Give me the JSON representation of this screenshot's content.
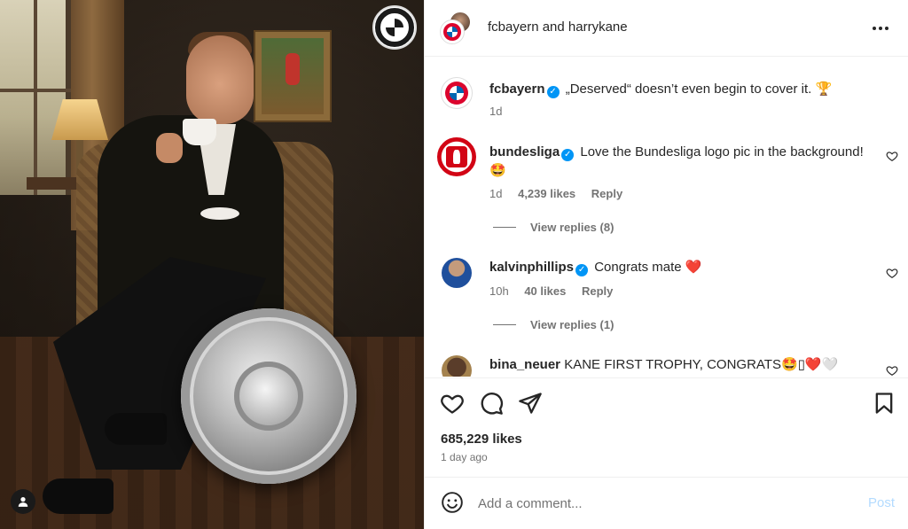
{
  "post": {
    "header_title": "fcbayern and harrykane",
    "likes_count": "685,229 likes",
    "time_ago": "1 day ago"
  },
  "media": {
    "logo_icon": "fc-bayern-logo",
    "tag_icon": "person-tag-icon"
  },
  "caption": {
    "username": "fcbayern",
    "text": "„Deserved“ doesn’t even begin to cover it. 🏆",
    "time": "1d"
  },
  "comments": [
    {
      "username": "bundesliga",
      "verified": true,
      "text": "Love the Bundesliga logo pic in the background!",
      "text2": "🤩",
      "time": "1d",
      "likes": "4,239 likes",
      "reply": "Reply",
      "view_replies": "View replies (8)"
    },
    {
      "username": "kalvinphillips",
      "verified": true,
      "text": "Congrats mate ❤️",
      "time": "10h",
      "likes": "40 likes",
      "reply": "Reply",
      "view_replies": "View replies (1)"
    },
    {
      "username": "bina_neuer",
      "verified": false,
      "text": "KANE FIRST TROPHY, CONGRATS🤩▯❤️🤍"
    }
  ],
  "add_comment": {
    "placeholder": "Add a comment...",
    "post_label": "Post"
  },
  "colors": {
    "link_blue": "#0095f6",
    "post_disabled": "#b3dbff",
    "meta_gray": "#737373",
    "text": "#262626"
  }
}
